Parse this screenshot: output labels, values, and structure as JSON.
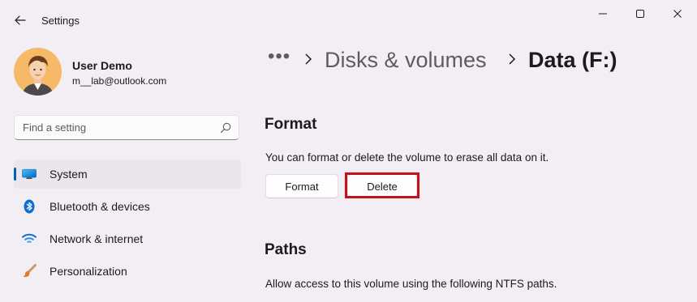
{
  "window": {
    "title": "Settings",
    "controls": {
      "minimize": "minimize-icon",
      "maximize": "maximize-icon",
      "close": "close-icon"
    }
  },
  "profile": {
    "name": "User Demo",
    "email": "m__lab@outlook.com"
  },
  "search": {
    "placeholder": "Find a setting"
  },
  "sidebar": {
    "items": [
      {
        "label": "System",
        "icon": "system-display-icon",
        "active": true
      },
      {
        "label": "Bluetooth & devices",
        "icon": "bluetooth-icon"
      },
      {
        "label": "Network & internet",
        "icon": "wifi-icon"
      },
      {
        "label": "Personalization",
        "icon": "brush-icon"
      }
    ]
  },
  "breadcrumb": {
    "more": "•••",
    "items": [
      "Disks & volumes"
    ],
    "current": "Data (F:)"
  },
  "format_section": {
    "title": "Format",
    "description": "You can format or delete the volume to erase all data on it.",
    "format_button": "Format",
    "delete_button": "Delete"
  },
  "paths_section": {
    "title": "Paths",
    "description": "Allow access to this volume using the following NTFS paths."
  },
  "colors": {
    "accent": "#005fb8",
    "highlight": "#c8101c",
    "background": "#f3eef3"
  }
}
